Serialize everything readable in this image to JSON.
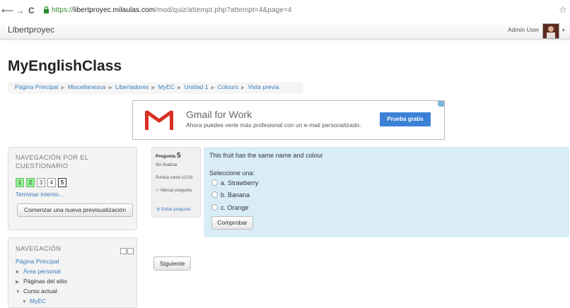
{
  "browser": {
    "back_icon": "back-arrow",
    "forward_icon": "forward-arrow",
    "reload_icon": "reload",
    "url_scheme": "https://",
    "url_host": "libertproyec.milaulas.com",
    "url_path": "/mod/quiz/attempt.php?attempt=4&page=4",
    "star_icon": "☆"
  },
  "navbar": {
    "brand": "Libertproyec",
    "user_name": "Admin User",
    "caret": "▾"
  },
  "site_title": "MyEnglishClass",
  "breadcrumb": [
    "Página Principal",
    "Miscellaneous",
    "Libertadores",
    "MyEC",
    "Unidad 1",
    "Colours",
    "Vista previa"
  ],
  "ad": {
    "title": "Gmail for Work",
    "subtitle": "Ahora puedes verte más profesional con un e-mail personalizado.",
    "cta": "Prueba gratis"
  },
  "quiz_nav": {
    "heading": "NAVEGACIÓN POR EL CUESTIONARIO",
    "pages": [
      "1",
      "2",
      "3",
      "4",
      "5"
    ],
    "finish_link": "Terminar intento...",
    "new_preview_button": "Comenzar una nueva previsualización"
  },
  "navigation": {
    "heading": "NAVEGACIÓN",
    "items": [
      {
        "label": "Página Principal",
        "marker": ""
      },
      {
        "label": "Área personal",
        "marker": "■"
      },
      {
        "label": "Páginas del sitio",
        "marker": "▶"
      },
      {
        "label": "Curso actual",
        "marker": "▼"
      },
      {
        "label": "MyEC",
        "marker": "▼"
      }
    ]
  },
  "question": {
    "label": "Pregunta",
    "number": "5",
    "status": "Sin finalizar",
    "score": "Puntúa como 10,00",
    "flag_label": "Marcar pregunta",
    "edit_link": "Editar pregunta",
    "text": "This fruit has the same name and colour",
    "prompt": "Seleccione una:",
    "options": [
      "a. Strawberry",
      "b. Banana",
      "c. Orange"
    ],
    "check_button": "Comprobar"
  },
  "next_button": "Siguiente"
}
